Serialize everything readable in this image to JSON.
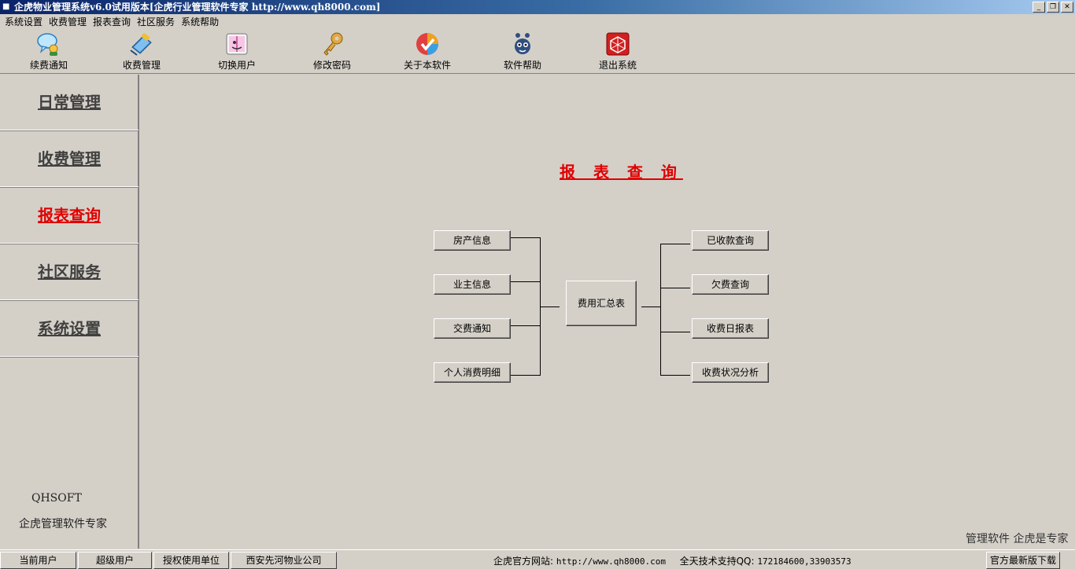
{
  "window": {
    "title": "企虎物业管理系统v6.0试用版本[企虎行业管理软件专家 http://www.qh8000.com]",
    "minimize": "_",
    "restore": "❐",
    "close": "✕"
  },
  "menubar": {
    "items": [
      "系统设置",
      "收费管理",
      "报表查询",
      "社区服务",
      "系统帮助"
    ]
  },
  "toolbar": {
    "items": [
      {
        "label": "续费通知",
        "icon": "notification-icon"
      },
      {
        "label": "收费管理",
        "icon": "payment-book-icon"
      },
      {
        "label": "切换用户",
        "icon": "switch-user-icon"
      },
      {
        "label": "修改密码",
        "icon": "key-icon"
      },
      {
        "label": "关于本软件",
        "icon": "about-icon"
      },
      {
        "label": "软件帮助",
        "icon": "help-icon"
      },
      {
        "label": "退出系统",
        "icon": "exit-icon"
      }
    ]
  },
  "sidebar": {
    "items": [
      {
        "label": "日常管理",
        "active": false
      },
      {
        "label": "收费管理",
        "active": false
      },
      {
        "label": "报表查询",
        "active": true
      },
      {
        "label": "社区服务",
        "active": false
      },
      {
        "label": "系统设置",
        "active": false
      }
    ],
    "brand_name": "QHSOFT",
    "brand_tagline": "企虎管理软件专家"
  },
  "main": {
    "heading": "报 表 查 询",
    "left_buttons": [
      "房产信息",
      "业主信息",
      "交费通知",
      "个人消费明细"
    ],
    "center_button": "费用汇总表",
    "right_buttons": [
      "已收款查询",
      "欠费查询",
      "收费日报表",
      "收费状况分析"
    ],
    "slogan": "管理软件  企虎是专家"
  },
  "statusbar": {
    "current_user_label": "当前用户",
    "user_role": "超级用户",
    "licensed_label": "授权使用单位",
    "company": "西安先河物业公司",
    "website_label": "企虎官方网站:",
    "website_url": "http://www.qh8000.com",
    "support_label": "全天技术支持QQ:",
    "support_qq": "172184600,33903573",
    "download_label": "官方最新版下载"
  },
  "colors": {
    "accent_red": "#e00000",
    "titlebar_start": "#0a246a",
    "titlebar_end": "#a6caf0",
    "face": "#d4d0c8"
  }
}
